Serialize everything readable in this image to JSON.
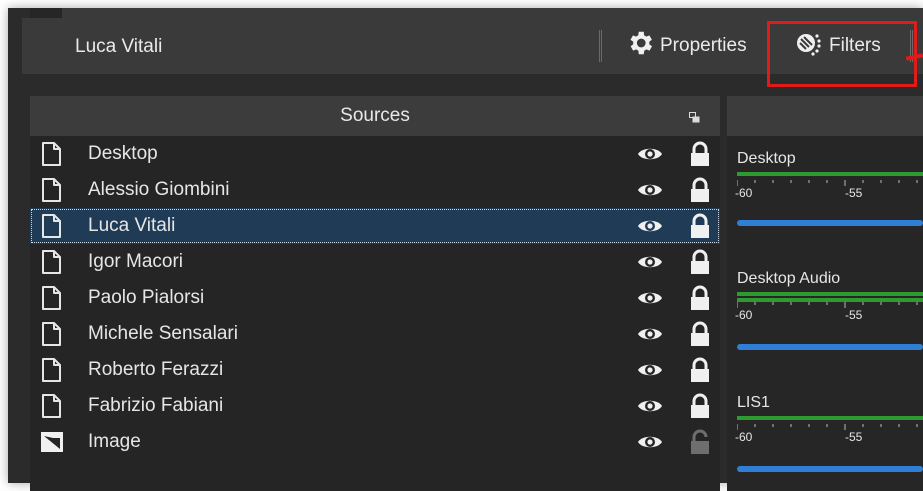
{
  "toolbar": {
    "selected_source": "Luca Vitali",
    "properties_label": "Properties",
    "filters_label": "Filters"
  },
  "sources": {
    "title": "Sources",
    "items": [
      {
        "label": "Desktop",
        "type": "file",
        "visible": true,
        "locked": true,
        "selected": false
      },
      {
        "label": "Alessio Giombini",
        "type": "file",
        "visible": true,
        "locked": true,
        "selected": false
      },
      {
        "label": "Luca Vitali",
        "type": "file",
        "visible": true,
        "locked": true,
        "selected": true
      },
      {
        "label": "Igor Macori",
        "type": "file",
        "visible": true,
        "locked": true,
        "selected": false
      },
      {
        "label": "Paolo Pialorsi",
        "type": "file",
        "visible": true,
        "locked": true,
        "selected": false
      },
      {
        "label": "Michele Sensalari",
        "type": "file",
        "visible": true,
        "locked": true,
        "selected": false
      },
      {
        "label": "Roberto Ferazzi",
        "type": "file",
        "visible": true,
        "locked": true,
        "selected": false
      },
      {
        "label": "Fabrizio Fabiani",
        "type": "file",
        "visible": true,
        "locked": true,
        "selected": false
      },
      {
        "label": "Image",
        "type": "image",
        "visible": true,
        "locked": false,
        "selected": false
      }
    ]
  },
  "mixer": {
    "channels": [
      {
        "name": "Desktop",
        "tick_labels": [
          "-60",
          "-55"
        ]
      },
      {
        "name": "Desktop Audio",
        "tick_labels": [
          "-60",
          "-55"
        ]
      },
      {
        "name": "LIS1",
        "tick_labels": [
          "-60",
          "-55"
        ]
      }
    ]
  },
  "colors": {
    "highlight": "#e11a1a",
    "selection": "#1f3b55",
    "meter_green": "#2f9a2f",
    "volume_blue": "#2f7fd4"
  }
}
